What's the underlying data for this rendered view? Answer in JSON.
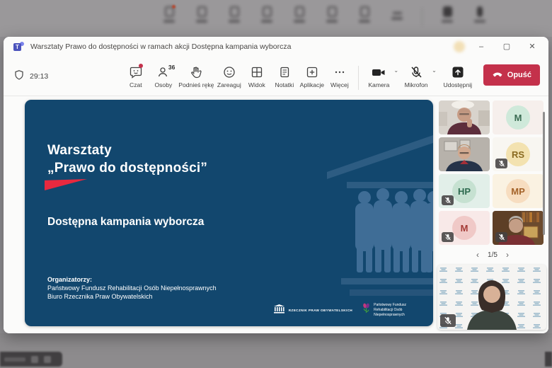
{
  "window": {
    "title": "Warsztaty Prawo do dostępności w ramach akcji Dostępna kampania wyborcza",
    "controls": {
      "minimize": "–",
      "maximize": "▢",
      "close": "✕"
    }
  },
  "toolbar": {
    "timer": "29:13",
    "people_count": "36",
    "buttons": [
      {
        "id": "czat",
        "label": "Czat",
        "has_notification_dot": true
      },
      {
        "id": "osoby",
        "label": "Osoby"
      },
      {
        "id": "podnies-reke",
        "label": "Podnieś rękę"
      },
      {
        "id": "zareaguj",
        "label": "Zareaguj"
      },
      {
        "id": "widok",
        "label": "Widok"
      },
      {
        "id": "notatki",
        "label": "Notatki"
      },
      {
        "id": "aplikacje",
        "label": "Aplikacje"
      },
      {
        "id": "wiecej",
        "label": "Więcej",
        "glyph": "⋯"
      }
    ],
    "devices": [
      {
        "id": "kamera",
        "label": "Kamera",
        "state": "on"
      },
      {
        "id": "mikrofon",
        "label": "Mikrofon",
        "state": "muted"
      },
      {
        "id": "udostepnij",
        "label": "Udostępnij",
        "state": "sharing"
      }
    ],
    "leave_label": "Opuść"
  },
  "slide": {
    "title_line1": "Warsztaty",
    "title_line2": "„Prawo do dostępności”",
    "subtitle": "Dostępna kampania wyborcza",
    "organizers_heading": "Organizatorzy:",
    "organizers": [
      "Państwowy Fundusz Rehabilitacji Osób Niepełnosprawnych",
      "Biuro Rzecznika Praw Obywatelskich"
    ],
    "logo_rpo_text": "RZECZNIK PRAW OBYWATELSKICH",
    "logo_pfron_lines": [
      "Państwowy Fundusz",
      "Rehabilitacji Osób",
      "Niepełnosprawnych"
    ],
    "colors": {
      "background": "#12476e",
      "accent_red": "#e8293f",
      "watermark_figures": "#3f6d96",
      "watermark_building": "#2d5c82"
    }
  },
  "participants": {
    "tiles": [
      {
        "type": "video",
        "desc": "man with glasses, dark red shirt, office ceiling"
      },
      {
        "type": "avatar",
        "initials": "M"
      },
      {
        "type": "video",
        "desc": "woman with glasses, navy jacket, office wall"
      },
      {
        "type": "avatar",
        "initials": "RS",
        "muted": true
      },
      {
        "type": "avatar",
        "initials": "HP",
        "muted": true
      },
      {
        "type": "avatar",
        "initials": "MP"
      },
      {
        "type": "avatar",
        "initials": "M",
        "muted": true
      },
      {
        "type": "video",
        "desc": "gray-haired man, red shirt, bookshelves",
        "muted": true
      }
    ],
    "pagination": {
      "prev": "‹",
      "current": "1/5",
      "next": "›"
    },
    "spotlight": {
      "type": "video",
      "desc": "woman, dark hair, green top, logo press wall",
      "muted": true
    }
  },
  "colors": {
    "teams_brand": "#4b53bc",
    "leave_red": "#c4314b",
    "notification_red": "#c4314b",
    "avatar_palettes": {
      "M_green": {
        "bg": "#f6efec",
        "circle": "#cfe9da",
        "text": "#3a6b52"
      },
      "RS_gold": {
        "bg": "#f8f6f1",
        "circle": "#f3e2b0",
        "text": "#8a6a20"
      },
      "HP_mint": {
        "bg": "#e2efe9",
        "circle": "#c6e1d1",
        "text": "#2e6b4f"
      },
      "MP_peach": {
        "bg": "#faf2e2",
        "circle": "#f7ddc0",
        "text": "#a4632a"
      },
      "M_pink": {
        "bg": "#f8e9e8",
        "circle": "#f0c9c7",
        "text": "#a43a35"
      }
    }
  }
}
